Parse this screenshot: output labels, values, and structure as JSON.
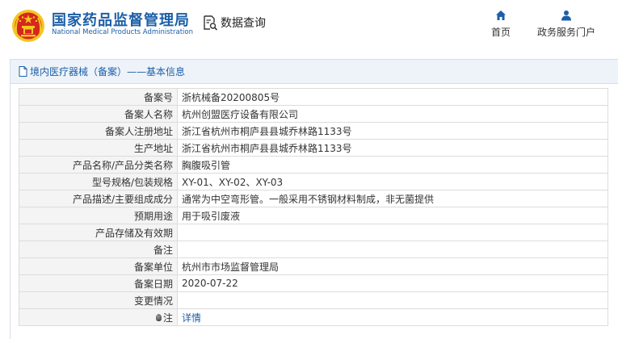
{
  "header": {
    "brand_cn": "国家药品监督管理局",
    "brand_en": "National Medical Products Administration",
    "query_label": "数据查询",
    "nav": {
      "home": "首页",
      "portal": "政务服务门户"
    }
  },
  "panel": {
    "title": "境内医疗器械（备案）——基本信息"
  },
  "rows": [
    {
      "label": "备案号",
      "value": "浙杭械备20200805号"
    },
    {
      "label": "备案人名称",
      "value": "杭州创盟医疗设备有限公司"
    },
    {
      "label": "备案人注册地址",
      "value": "浙江省杭州市桐庐县县城乔林路1133号"
    },
    {
      "label": "生产地址",
      "value": "浙江省杭州市桐庐县县城乔林路1133号"
    },
    {
      "label": "产品名称/产品分类名称",
      "value": "胸腹吸引管"
    },
    {
      "label": "型号规格/包装规格",
      "value": "XY-01、XY-02、XY-03"
    },
    {
      "label": "产品描述/主要组成成分",
      "value": "通常为中空弯形管。一般采用不锈钢材料制成，非无菌提供"
    },
    {
      "label": "预期用途",
      "value": "用于吸引废液"
    },
    {
      "label": "产品存储及有效期",
      "value": ""
    },
    {
      "label": "备注",
      "value": ""
    },
    {
      "label": "备案单位",
      "value": "杭州市市场监督管理局"
    },
    {
      "label": "备案日期",
      "value": "2020-07-22"
    },
    {
      "label": "变更情况",
      "value": ""
    }
  ],
  "note_row": {
    "label": "注",
    "link": "详情"
  },
  "colors": {
    "brand_blue": "#1b5fa8",
    "emblem_red": "#d7261e",
    "emblem_gold": "#f3c623"
  }
}
